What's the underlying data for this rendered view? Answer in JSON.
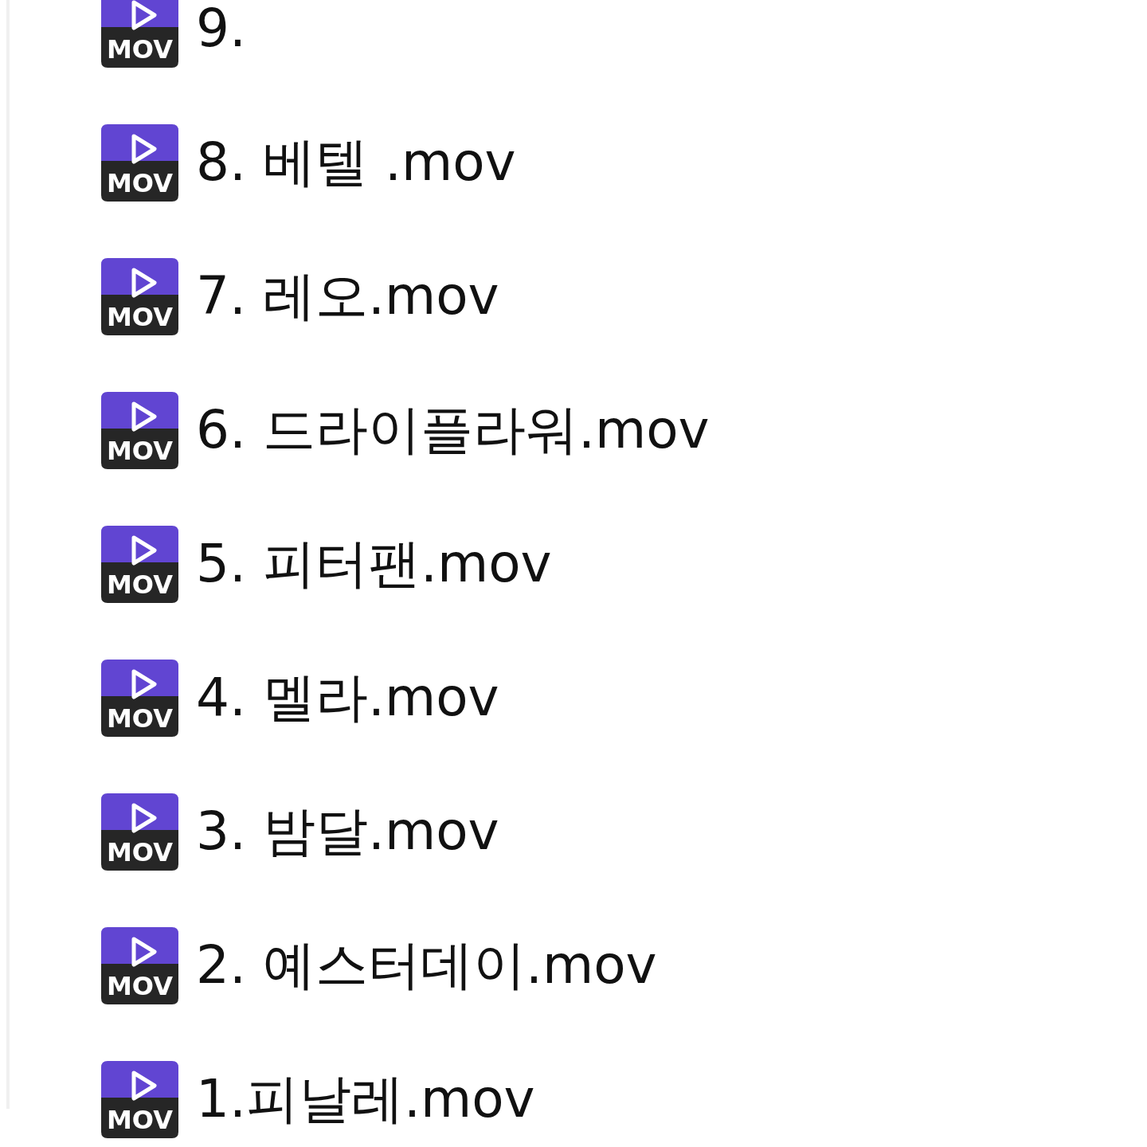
{
  "files": [
    {
      "name": "9.",
      "icon_label": "MOV"
    },
    {
      "name": "8. 베텔 .mov",
      "icon_label": "MOV"
    },
    {
      "name": "7. 레오.mov",
      "icon_label": "MOV"
    },
    {
      "name": "6. 드라이플라워.mov",
      "icon_label": "MOV"
    },
    {
      "name": "5. 피터팬.mov",
      "icon_label": "MOV"
    },
    {
      "name": "4. 멜라.mov",
      "icon_label": "MOV"
    },
    {
      "name": "3. 밤달.mov",
      "icon_label": "MOV"
    },
    {
      "name": "2. 예스터데이.mov",
      "icon_label": "MOV"
    },
    {
      "name": "1.피날레.mov",
      "icon_label": "MOV"
    }
  ]
}
